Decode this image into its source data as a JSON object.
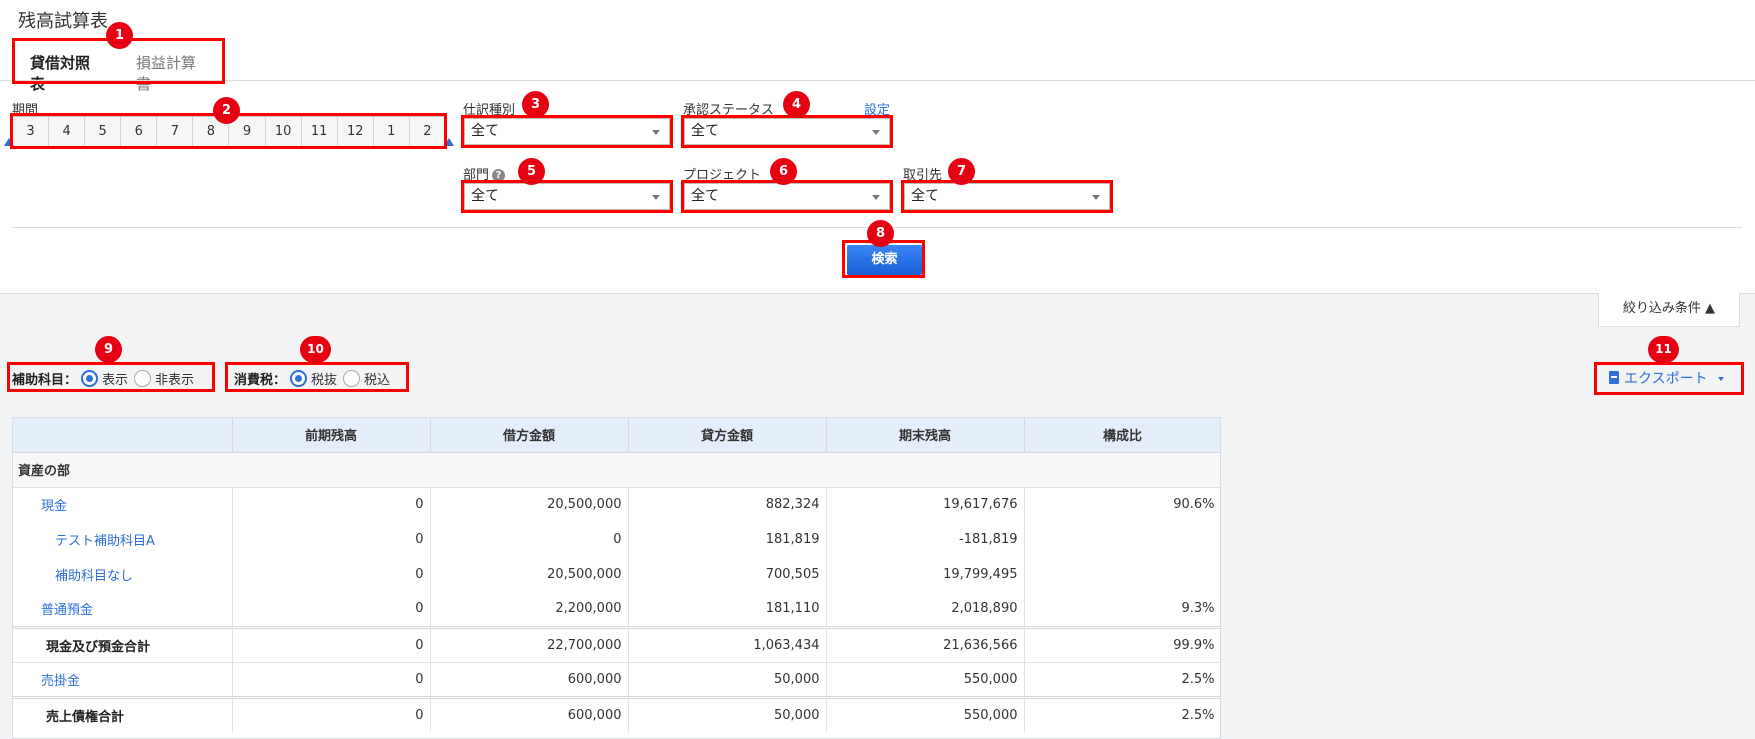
{
  "page": {
    "title": "残高試算表"
  },
  "tabs": [
    {
      "label": "貸借対照表",
      "active": true
    },
    {
      "label": "損益計算書",
      "active": false
    }
  ],
  "filters": {
    "period_label": "期間",
    "months": [
      "3",
      "4",
      "5",
      "6",
      "7",
      "8",
      "9",
      "10",
      "11",
      "12",
      "1",
      "2"
    ],
    "journal_type_label": "仕訳種別",
    "journal_type_value": "全て",
    "approval_label": "承認ステータス",
    "approval_value": "全て",
    "settings_link": "設定",
    "department_label": "部門",
    "department_value": "全て",
    "project_label": "プロジェクト",
    "project_value": "全て",
    "partner_label": "取引先",
    "partner_value": "全て",
    "search_button": "検索",
    "narrow_toggle": "絞り込み条件 ▲"
  },
  "options": {
    "sub_account_label": "補助科目：",
    "sub_show": "表示",
    "sub_hide": "非表示",
    "tax_label": "消費税：",
    "tax_excluded": "税抜",
    "tax_included": "税込",
    "export_label": "エクスポート"
  },
  "badges": [
    "1",
    "2",
    "3",
    "4",
    "5",
    "6",
    "7",
    "8",
    "9",
    "10",
    "11"
  ],
  "table": {
    "headers": [
      "",
      "前期残高",
      "借方金額",
      "貸方金額",
      "期末残高",
      "構成比"
    ],
    "section": "資産の部",
    "rows": [
      {
        "kind": "acc",
        "name": "現金",
        "prev": "0",
        "debit": "20,500,000",
        "credit": "882,324",
        "end": "19,617,676",
        "ratio": "90.6%"
      },
      {
        "kind": "sub",
        "name": "テスト補助科目A",
        "prev": "0",
        "debit": "0",
        "credit": "181,819",
        "end": "-181,819",
        "ratio": ""
      },
      {
        "kind": "sub",
        "name": "補助科目なし",
        "prev": "0",
        "debit": "20,500,000",
        "credit": "700,505",
        "end": "19,799,495",
        "ratio": ""
      },
      {
        "kind": "acc",
        "name": "普通預金",
        "prev": "0",
        "debit": "2,200,000",
        "credit": "181,110",
        "end": "2,018,890",
        "ratio": "9.3%"
      },
      {
        "kind": "tot",
        "name": "現金及び預金合計",
        "prev": "0",
        "debit": "22,700,000",
        "credit": "1,063,434",
        "end": "21,636,566",
        "ratio": "99.9%"
      },
      {
        "kind": "acc",
        "name": "売掛金",
        "prev": "0",
        "debit": "600,000",
        "credit": "50,000",
        "end": "550,000",
        "ratio": "2.5%"
      },
      {
        "kind": "tot",
        "name": "売上債権合計",
        "prev": "0",
        "debit": "600,000",
        "credit": "50,000",
        "end": "550,000",
        "ratio": "2.5%"
      }
    ]
  }
}
